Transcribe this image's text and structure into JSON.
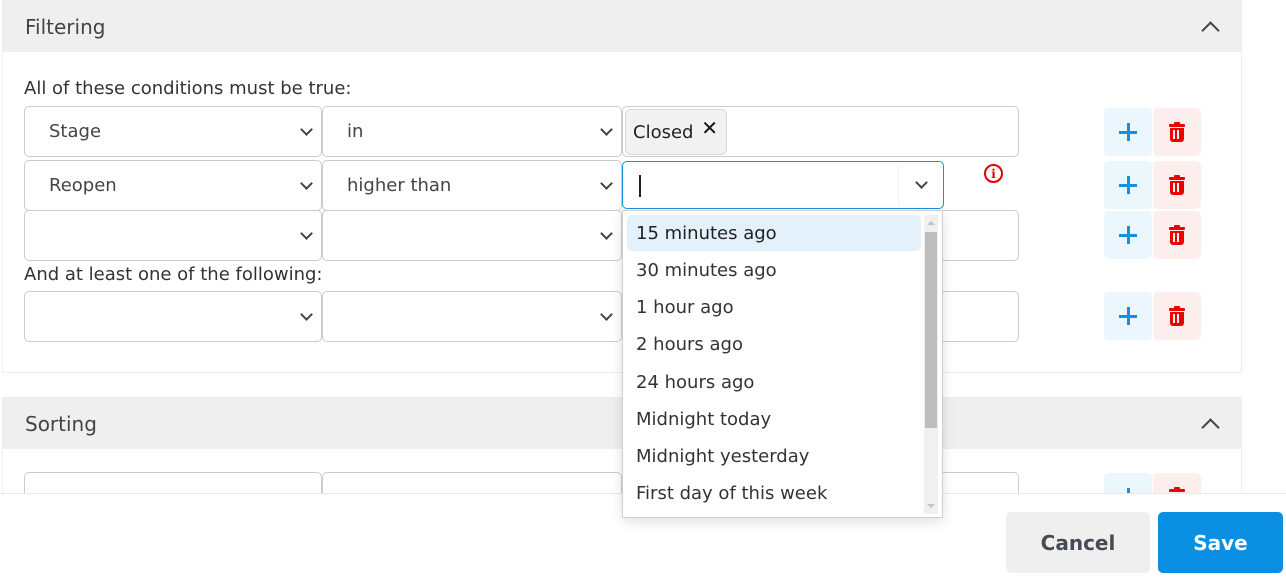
{
  "filtering": {
    "title": "Filtering",
    "all_label": "All of these conditions must be true:",
    "any_label": "And at least one of the following:",
    "all_rows": [
      {
        "field": "Stage",
        "operator": "in",
        "tags": [
          "Closed"
        ]
      },
      {
        "field": "Reopen",
        "operator": "higher than",
        "value": ""
      },
      {
        "field": "",
        "operator": "",
        "value": ""
      }
    ],
    "any_rows": [
      {
        "field": "",
        "operator": "",
        "value": ""
      }
    ]
  },
  "value_dropdown": {
    "options": [
      "15 minutes ago",
      "30 minutes ago",
      "1 hour ago",
      "2 hours ago",
      "24 hours ago",
      "Midnight today",
      "Midnight yesterday",
      "First day of this week"
    ],
    "highlighted": "15 minutes ago"
  },
  "sorting": {
    "title": "Sorting"
  },
  "icons": {
    "tag_remove": "✕",
    "info": "i"
  },
  "footer": {
    "cancel_label": "Cancel",
    "save_label": "Save"
  },
  "colors": {
    "accent": "#0a8fe2",
    "danger": "#e00000",
    "add_bg": "#ebf6fd",
    "delete_bg": "#fdeeee"
  }
}
